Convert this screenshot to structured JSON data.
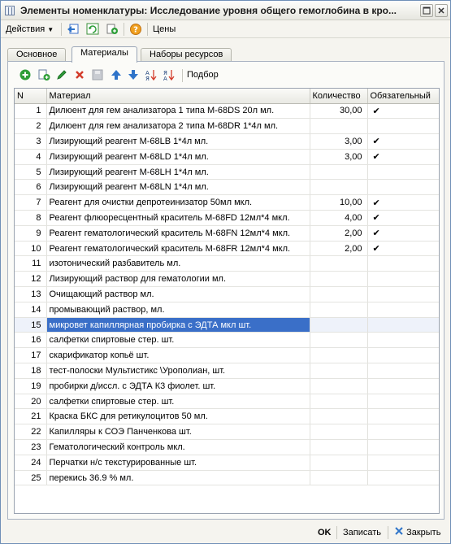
{
  "window": {
    "title": "Элементы номенклатуры: Исследование уровня общего гемоглобина в кро..."
  },
  "toolbar": {
    "actions_label": "Действия",
    "prices_label": "Цены"
  },
  "tabs": [
    {
      "label": "Основное"
    },
    {
      "label": "Материалы"
    },
    {
      "label": "Наборы ресурсов"
    }
  ],
  "subtoolbar": {
    "pick_label": "Подбор"
  },
  "table": {
    "headers": {
      "n": "N",
      "material": "Материал",
      "quantity": "Количество",
      "required": "Обязательный"
    },
    "rows": [
      {
        "n": "1",
        "material": "Дилюент для гем анализатора 1 типа M-68DS 20л мл.",
        "quantity": "30,00",
        "required": "✔"
      },
      {
        "n": "2",
        "material": "Дилюент для гем анализатора 2 типа M-68DR 1*4л мл.",
        "quantity": "",
        "required": ""
      },
      {
        "n": "3",
        "material": "Лизирующий реагент М-68LB 1*4л мл.",
        "quantity": "3,00",
        "required": "✔"
      },
      {
        "n": "4",
        "material": "Лизирующий реагент М-68LD 1*4л мл.",
        "quantity": "3,00",
        "required": "✔"
      },
      {
        "n": "5",
        "material": "Лизирующий реагент М-68LH 1*4л мл.",
        "quantity": "",
        "required": ""
      },
      {
        "n": "6",
        "material": "Лизирующий реагент М-68LN 1*4л мл.",
        "quantity": "",
        "required": ""
      },
      {
        "n": "7",
        "material": "Реагент для очистки депротеинизатор 50мл мкл.",
        "quantity": "10,00",
        "required": "✔"
      },
      {
        "n": "8",
        "material": "Реагент флюоресцентный краситель М-68FD 12мл*4  мкл.",
        "quantity": "4,00",
        "required": "✔"
      },
      {
        "n": "9",
        "material": "Реагент гематологический краситель М-68FN 12мл*4  мкл.",
        "quantity": "2,00",
        "required": "✔"
      },
      {
        "n": "10",
        "material": "Реагент гематологический краситель М-68FR 12мл*4  мкл.",
        "quantity": "2,00",
        "required": "✔"
      },
      {
        "n": "11",
        "material": "изотонический разбавитель  мл.",
        "quantity": "",
        "required": ""
      },
      {
        "n": "12",
        "material": "Лизирующий раствор для гематологии мл.",
        "quantity": "",
        "required": ""
      },
      {
        "n": "13",
        "material": "Очищающий раствор мл.",
        "quantity": "",
        "required": ""
      },
      {
        "n": "14",
        "material": "промывающий раствор, мл.",
        "quantity": "",
        "required": ""
      },
      {
        "n": "15",
        "material": "микровет капиллярная пробирка с ЭДТА мкл шт.",
        "quantity": "",
        "required": ""
      },
      {
        "n": "16",
        "material": "салфетки спиртовые стер. шт.",
        "quantity": "",
        "required": ""
      },
      {
        "n": "17",
        "material": "скарификатор копьё шт.",
        "quantity": "",
        "required": ""
      },
      {
        "n": "18",
        "material": "тест-полоски Мультистикс \\Урополиан, шт.",
        "quantity": "",
        "required": ""
      },
      {
        "n": "19",
        "material": "пробирки д/иссл. с ЭДТА К3 фиолет. шт.",
        "quantity": "",
        "required": ""
      },
      {
        "n": "20",
        "material": "салфетки спиртовые стер. шт.",
        "quantity": "",
        "required": ""
      },
      {
        "n": "21",
        "material": "Краска БКС для ретикулоцитов 50 мл.",
        "quantity": "",
        "required": ""
      },
      {
        "n": "22",
        "material": "Капилляры к СОЭ Панченкова шт.",
        "quantity": "",
        "required": ""
      },
      {
        "n": "23",
        "material": "Гематологический контроль мкл.",
        "quantity": "",
        "required": ""
      },
      {
        "n": "24",
        "material": "Перчатки н/с текстурированные шт.",
        "quantity": "",
        "required": ""
      },
      {
        "n": "25",
        "material": "перекись 36.9 % мл.",
        "quantity": "",
        "required": ""
      }
    ],
    "selected_row": "15"
  },
  "footer": {
    "ok_label": "OK",
    "save_label": "Записать",
    "close_label": "Закрыть"
  },
  "icons": {
    "title": "grid-window-icon",
    "add": "add-row-icon",
    "copy": "copy-row-icon",
    "edit": "edit-pencil-icon",
    "delete": "delete-x-icon",
    "up": "move-up-icon",
    "down": "move-down-icon",
    "sort_asc": "sort-ascending-icon",
    "sort_desc": "sort-descending-icon"
  },
  "colors": {
    "selection": "#3a6fc8",
    "check": "#1a1a1a",
    "add_green": "#2e9e38",
    "delete_red": "#d33c2b",
    "arrow_blue": "#2f74c9"
  }
}
